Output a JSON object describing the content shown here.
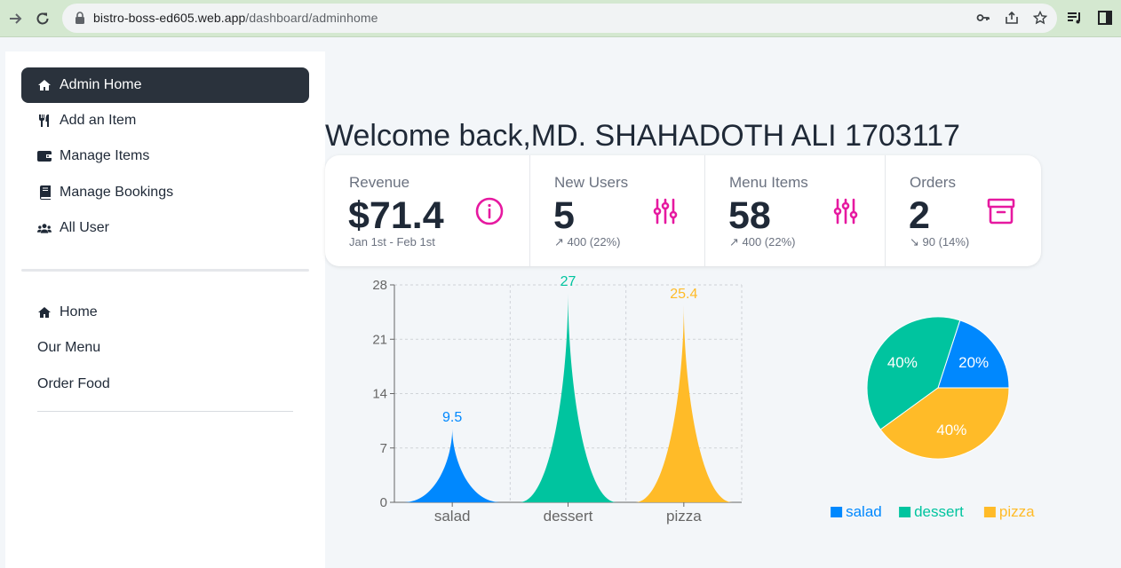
{
  "browser": {
    "url_host": "bistro-boss-ed605.web.app",
    "url_path": "/dashboard/adminhome"
  },
  "sidebar": {
    "items": [
      {
        "label": "Admin Home",
        "icon": "home-icon",
        "active": true
      },
      {
        "label": "Add an Item",
        "icon": "utensils-icon",
        "active": false
      },
      {
        "label": "Manage Items",
        "icon": "wallet-icon",
        "active": false
      },
      {
        "label": "Manage Bookings",
        "icon": "book-icon",
        "active": false
      },
      {
        "label": "All User",
        "icon": "users-icon",
        "active": false
      }
    ],
    "bottom_items": [
      {
        "label": "Home",
        "icon": "home-icon"
      },
      {
        "label": "Our Menu"
      },
      {
        "label": "Order Food"
      }
    ]
  },
  "main": {
    "welcome": "Welcome back,MD. SHAHADOTH ALI 1703117",
    "stats": [
      {
        "title": "Revenue",
        "value": "$71.4",
        "desc": "Jan 1st - Feb 1st",
        "icon": "info-circle-icon"
      },
      {
        "title": "New Users",
        "value": "5",
        "desc": "↗ 400 (22%)",
        "icon": "sliders-icon"
      },
      {
        "title": "Menu Items",
        "value": "58",
        "desc": "↗ 400 (22%)",
        "icon": "sliders-icon"
      },
      {
        "title": "Orders",
        "value": "2",
        "desc": "↘ 90 (14%)",
        "icon": "archive-icon"
      }
    ]
  },
  "colors": {
    "accent": "#e619a0",
    "salad": "#0088fe",
    "dessert": "#00c49f",
    "pizza": "#ffbb28"
  },
  "chart_data": [
    {
      "type": "bar",
      "categories": [
        "salad",
        "dessert",
        "pizza"
      ],
      "values": [
        9.5,
        27,
        25.4
      ],
      "ylim": [
        0,
        28
      ],
      "yticks": [
        0,
        7,
        14,
        21,
        28
      ],
      "grid": true,
      "colors": [
        "#0088fe",
        "#00c49f",
        "#ffbb28"
      ]
    },
    {
      "type": "pie",
      "categories": [
        "salad",
        "dessert",
        "pizza"
      ],
      "values": [
        20,
        40,
        40
      ],
      "labels": [
        "20%",
        "40%",
        "40%"
      ],
      "colors": [
        "#0088fe",
        "#00c49f",
        "#ffbb28"
      ],
      "legend": "bottom"
    }
  ]
}
